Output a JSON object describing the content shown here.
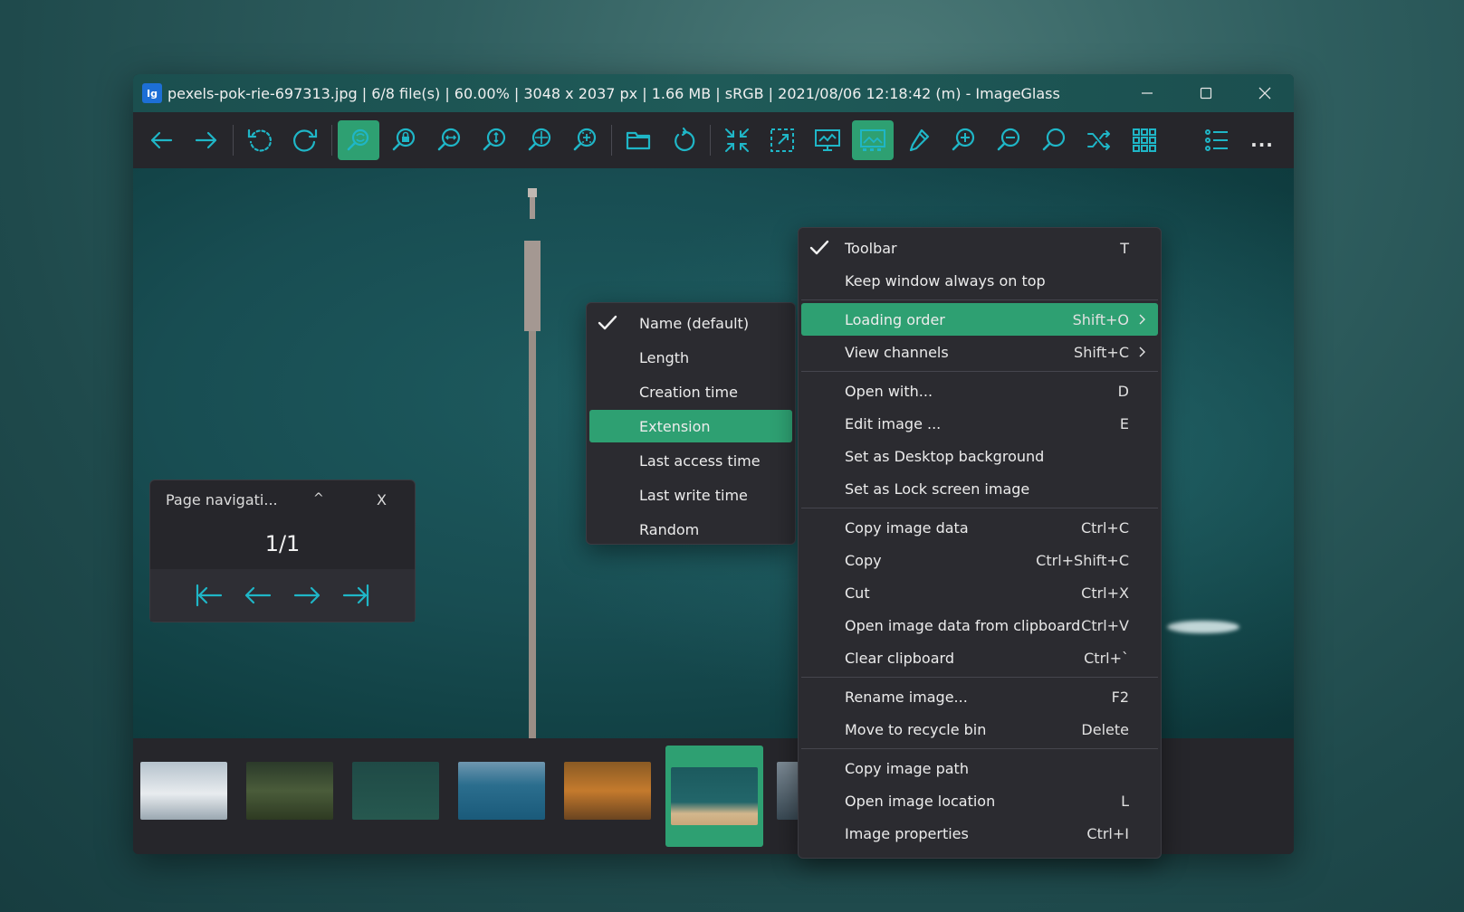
{
  "window": {
    "title": "pexels-pok-rie-697313.jpg  |  6/8 file(s)  |  60.00%  |  3048 x 2037 px  |  1.66 MB  |  sRGB  |  2021/08/06 12:18:42 (m)  - ImageGlass",
    "logo_text": "Ig"
  },
  "colors": {
    "accent": "#2ea072",
    "icon": "#1fb6c7",
    "menu_bg": "#2b2b30"
  },
  "toolbar": {
    "icons": [
      "arrow-left-icon",
      "arrow-right-icon",
      "rotate-left-icon",
      "rotate-right-icon",
      "auto-zoom-icon",
      "lock-zoom-icon",
      "scale-to-width-icon",
      "scale-to-height-icon",
      "scale-to-fit-icon",
      "scale-to-fill-icon",
      "open-folder-icon",
      "refresh-icon",
      "fullscreen-icon",
      "frameless-icon",
      "slideshow-icon",
      "checkerboard-icon",
      "color-picker-icon",
      "zoom-in-icon",
      "zoom-out-icon",
      "actual-size-icon",
      "shuffle-icon",
      "gallery-icon",
      "menu-icon",
      "more-icon"
    ],
    "more_label": "..."
  },
  "page_nav": {
    "title": "Page navigati...",
    "caret": "^",
    "close": "X",
    "count": "1/1"
  },
  "submenu": {
    "items": [
      {
        "label": "Name (default)",
        "checked": true
      },
      {
        "label": "Length"
      },
      {
        "label": "Creation time"
      },
      {
        "label": "Extension",
        "highlighted": true
      },
      {
        "label": "Last access time"
      },
      {
        "label": "Last write time"
      },
      {
        "label": "Random"
      }
    ]
  },
  "main_menu": {
    "groups": [
      [
        {
          "label": "Toolbar",
          "shortcut": "T",
          "checked": true
        },
        {
          "label": "Keep window always on top",
          "shortcut": ""
        }
      ],
      [
        {
          "label": "Loading order",
          "shortcut": "Shift+O",
          "submenu": true,
          "highlighted": true
        },
        {
          "label": "View channels",
          "shortcut": "Shift+C",
          "submenu": true
        }
      ],
      [
        {
          "label": "Open with...",
          "shortcut": "D"
        },
        {
          "label": "Edit image ...",
          "shortcut": "E"
        },
        {
          "label": "Set as Desktop background",
          "shortcut": ""
        },
        {
          "label": "Set as Lock screen image",
          "shortcut": ""
        }
      ],
      [
        {
          "label": "Copy image data",
          "shortcut": "Ctrl+C"
        },
        {
          "label": "Copy",
          "shortcut": "Ctrl+Shift+C"
        },
        {
          "label": "Cut",
          "shortcut": "Ctrl+X"
        },
        {
          "label": "Open image data from clipboard",
          "shortcut": "Ctrl+V"
        },
        {
          "label": "Clear clipboard",
          "shortcut": "Ctrl+`"
        }
      ],
      [
        {
          "label": "Rename image...",
          "shortcut": "F2"
        },
        {
          "label": "Move to recycle bin",
          "shortcut": "Delete"
        }
      ],
      [
        {
          "label": "Copy image path",
          "shortcut": ""
        },
        {
          "label": "Open image location",
          "shortcut": "L"
        },
        {
          "label": "Image properties",
          "shortcut": "Ctrl+I"
        }
      ]
    ]
  }
}
